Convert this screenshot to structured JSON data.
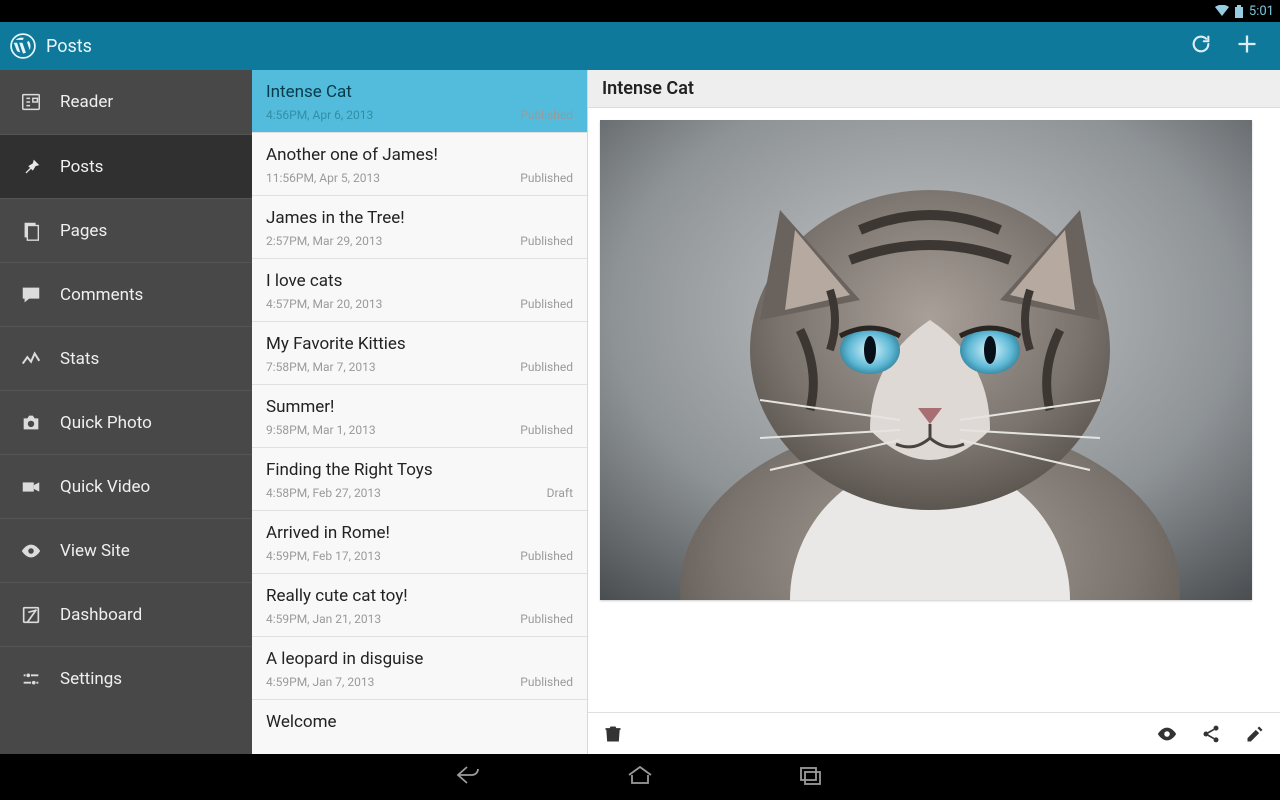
{
  "statusbar": {
    "time": "5:01"
  },
  "actionbar": {
    "title": "Posts"
  },
  "sidebar": {
    "items": [
      {
        "label": "Reader"
      },
      {
        "label": "Posts"
      },
      {
        "label": "Pages"
      },
      {
        "label": "Comments"
      },
      {
        "label": "Stats"
      },
      {
        "label": "Quick Photo"
      },
      {
        "label": "Quick Video"
      },
      {
        "label": "View Site"
      },
      {
        "label": "Dashboard"
      },
      {
        "label": "Settings"
      }
    ]
  },
  "posts": [
    {
      "title": "Intense Cat",
      "time": "4:56PM, Apr 6, 2013",
      "status": "Published"
    },
    {
      "title": "Another one of James!",
      "time": "11:56PM, Apr 5, 2013",
      "status": "Published"
    },
    {
      "title": "James in the Tree!",
      "time": "2:57PM, Mar 29, 2013",
      "status": "Published"
    },
    {
      "title": "I love cats",
      "time": "4:57PM, Mar 20, 2013",
      "status": "Published"
    },
    {
      "title": "My Favorite Kitties",
      "time": "7:58PM, Mar 7, 2013",
      "status": "Published"
    },
    {
      "title": "Summer!",
      "time": "9:58PM, Mar 1, 2013",
      "status": "Published"
    },
    {
      "title": "Finding the Right Toys",
      "time": "4:58PM, Feb 27, 2013",
      "status": "Draft"
    },
    {
      "title": "Arrived in Rome!",
      "time": "4:59PM, Feb 17, 2013",
      "status": "Published"
    },
    {
      "title": "Really cute cat toy!",
      "time": "4:59PM, Jan 21, 2013",
      "status": "Published"
    },
    {
      "title": "A leopard in disguise",
      "time": "4:59PM, Jan 7, 2013",
      "status": "Published"
    },
    {
      "title": "Welcome",
      "time": "",
      "status": ""
    }
  ],
  "detail": {
    "title": "Intense Cat"
  }
}
